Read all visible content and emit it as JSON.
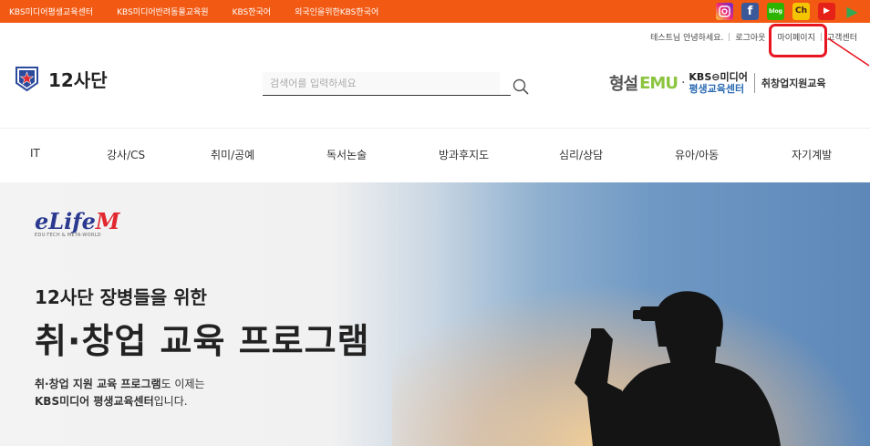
{
  "topbar": {
    "links": [
      "KBS미디어평생교육센터",
      "KBS미디어반려동물교육원",
      "KBS한국어",
      "외국인을위한KBS한국어"
    ],
    "social": [
      {
        "name": "instagram-icon",
        "label": "",
        "color": "#d62976"
      },
      {
        "name": "facebook-icon",
        "label": "f",
        "color": "#3b5998"
      },
      {
        "name": "blog-icon",
        "label": "blog",
        "color": "#2db400"
      },
      {
        "name": "channel-icon",
        "label": "Ch",
        "color": "#f5c400"
      },
      {
        "name": "youtube-icon",
        "label": "▶",
        "color": "#e62117"
      },
      {
        "name": "playstore-icon",
        "label": "▶",
        "color": "#34a853"
      }
    ]
  },
  "util": {
    "greeting": "테스트님 안녕하세요.",
    "logout": "로그아웃",
    "mypage": "마이페이지",
    "support": "고객센터"
  },
  "logo": {
    "name": "12사단"
  },
  "search": {
    "placeholder": "검색어를 입력하세요"
  },
  "partners": {
    "hyungseol": "형설",
    "emu": "EMU",
    "kbs_line1": "KBS⊖미디어",
    "kbs_line2": "평생교육센터",
    "job": "취창업지원교육"
  },
  "nav": {
    "items": [
      "IT",
      "강사/CS",
      "취미/공예",
      "독서논술",
      "방과후지도",
      "심리/상담",
      "유아/아동",
      "자기계발"
    ]
  },
  "banner": {
    "brand": "eLife",
    "brand_m": "M",
    "brand_sub": "EDU-TECH & META-WORLD",
    "headline1": "12사단 장병들을 위한",
    "headline2": "취·창업 교육 프로그램",
    "desc_bold1": "취·창업 지원 교육 프로그램",
    "desc_rest1": "도 이제는",
    "desc_bold2": "KBS미디어 평생교육센터",
    "desc_rest2": "입니다."
  }
}
